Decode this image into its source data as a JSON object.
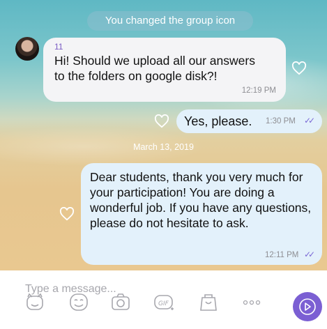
{
  "chat": {
    "system_message": "You changed the group icon",
    "messages": [
      {
        "sender": "11",
        "text": "Hi! Should we upload all our answers to the folders on google disk?!",
        "time": "12:19 PM"
      },
      {
        "text": "Yes, please.",
        "time": "1:30 PM"
      },
      {
        "text": "Dear students, thank you very much for your participation! You are doing a wonderful job. If you have any questions, please do not hesitate to ask.",
        "time": "12:11 PM"
      }
    ],
    "date_separator": "March 13, 2019"
  },
  "composer": {
    "placeholder": "Type a message..."
  },
  "toolbar": {
    "icons": [
      "sticker-icon",
      "emoji-icon",
      "camera-icon",
      "gif-icon",
      "shopping-bag-icon",
      "more-icon"
    ]
  },
  "colors": {
    "accent": "#7b5fd3",
    "outgoing_bubble": "#e3f1fb",
    "incoming_bubble": "#f4f4f6"
  }
}
